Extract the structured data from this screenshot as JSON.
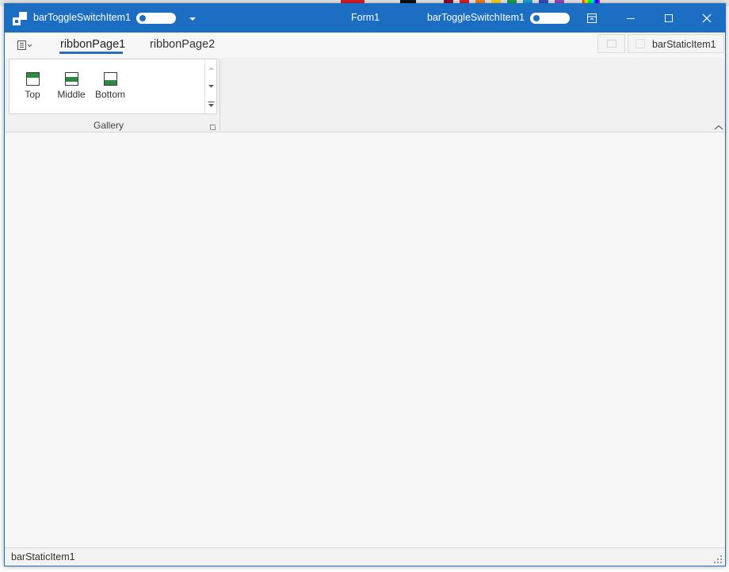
{
  "titlebar": {
    "left_toggle_label": "barToggleSwitchItem1",
    "form_title": "Form1",
    "right_toggle_label": "barToggleSwitchItem1",
    "accent_color": "#1b6ec2"
  },
  "ribbon": {
    "tabs": [
      {
        "label": "ribbonPage1",
        "active": true
      },
      {
        "label": "ribbonPage2",
        "active": false
      }
    ],
    "header_static_item": "barStaticItem1",
    "gallery_group": {
      "label": "Gallery",
      "items": [
        {
          "label": "Top",
          "icon": "align-top-icon"
        },
        {
          "label": "Middle",
          "icon": "align-middle-icon"
        },
        {
          "label": "Bottom",
          "icon": "align-bottom-icon"
        }
      ]
    }
  },
  "statusbar": {
    "text": "barStaticItem1"
  }
}
